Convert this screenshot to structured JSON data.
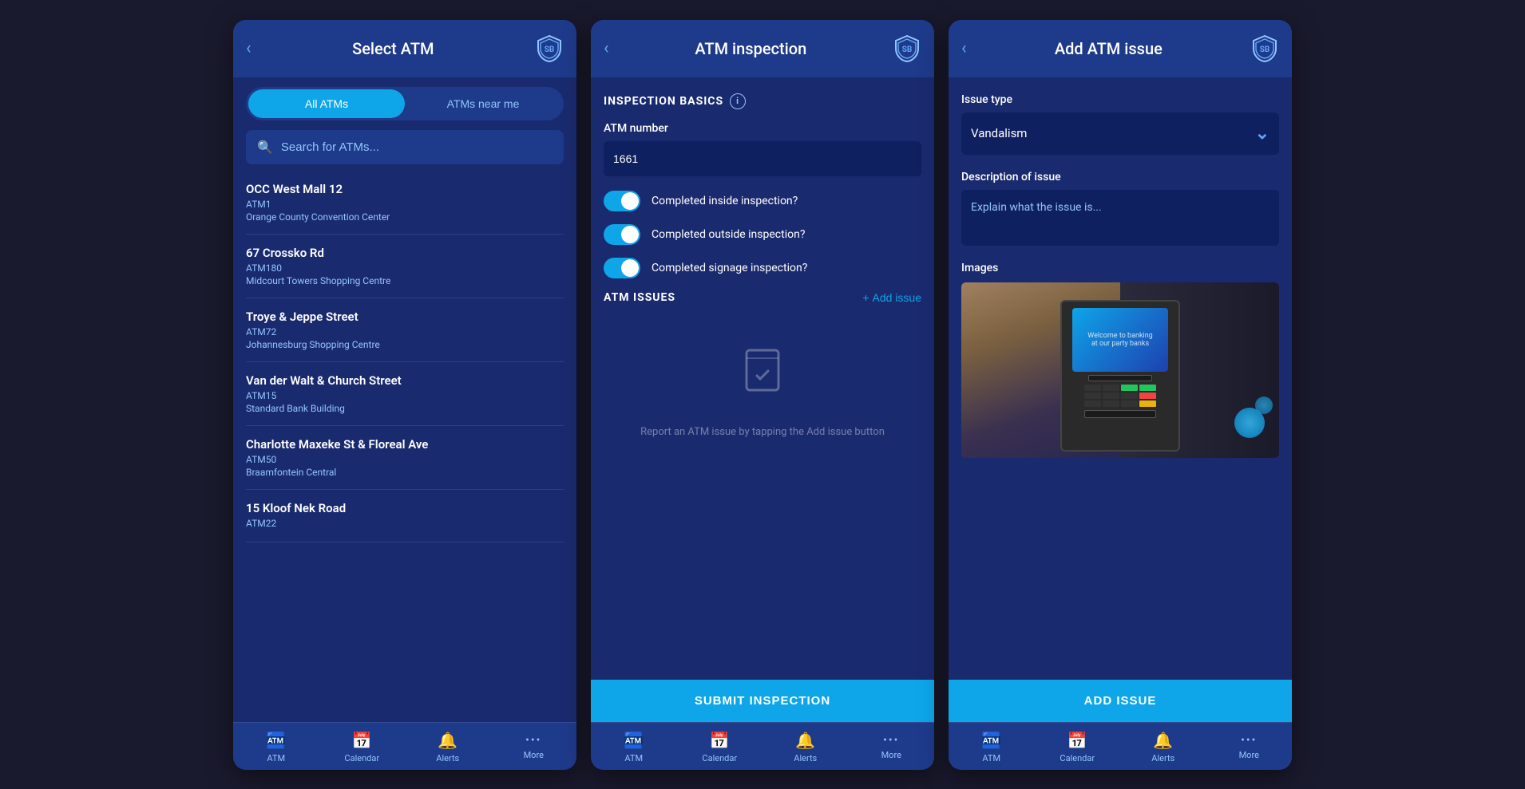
{
  "screen1": {
    "title": "Select ATM",
    "back_label": "‹",
    "tabs": {
      "all_atms": "All ATMs",
      "atms_near_me": "ATMs near me"
    },
    "search_placeholder": "Search for ATMs...",
    "atm_list": [
      {
        "name": "OCC West Mall 12",
        "code": "ATM1",
        "location": "Orange County Convention Center"
      },
      {
        "name": "67 Crossko Rd",
        "code": "ATM180",
        "location": "Midcourt Towers Shopping Centre"
      },
      {
        "name": "Troye & Jeppe Street",
        "code": "ATM72",
        "location": "Johannesburg Shopping Centre"
      },
      {
        "name": "Van der Walt & Church Street",
        "code": "ATM15",
        "location": "Standard Bank Building"
      },
      {
        "name": "Charlotte Maxeke St & Floreal Ave",
        "code": "ATM50",
        "location": "Braamfontein Central"
      },
      {
        "name": "15 Kloof Nek Road",
        "code": "ATM22",
        "location": ""
      }
    ],
    "nav": {
      "atm": "ATM",
      "calendar": "Calendar",
      "alerts": "Alerts",
      "more": "More"
    }
  },
  "screen2": {
    "title": "ATM inspection",
    "back_label": "‹",
    "inspection_basics_label": "INSPECTION BASICS",
    "atm_number_label": "ATM number",
    "atm_number_value": "1661",
    "toggles": [
      {
        "label": "Completed inside inspection?",
        "checked": true
      },
      {
        "label": "Completed outside inspection?",
        "checked": true
      },
      {
        "label": "Completed signage inspection?",
        "checked": true
      }
    ],
    "atm_issues_label": "ATM ISSUES",
    "add_issue_label": "Add issue",
    "empty_state_text": "Report an ATM issue by\ntapping the Add issue button",
    "submit_btn_label": "SUBMIT INSPECTION",
    "nav": {
      "atm": "ATM",
      "calendar": "Calendar",
      "alerts": "Alerts",
      "more": "More"
    }
  },
  "screen3": {
    "title": "Add ATM issue",
    "back_label": "‹",
    "issue_type_label": "Issue type",
    "issue_type_value": "Vandalism",
    "description_label": "Description of issue",
    "description_placeholder": "Explain what the issue is...",
    "images_label": "Images",
    "add_issue_btn_label": "ADD ISSUE",
    "nav": {
      "atm": "ATM",
      "calendar": "Calendar",
      "alerts": "Alerts",
      "more": "More"
    }
  },
  "icons": {
    "back": "‹",
    "atm_icon": "🏧",
    "calendar_icon": "📅",
    "alert_icon": "🔔",
    "more_icon": "•••",
    "search_icon": "🔍",
    "plus_icon": "+"
  }
}
